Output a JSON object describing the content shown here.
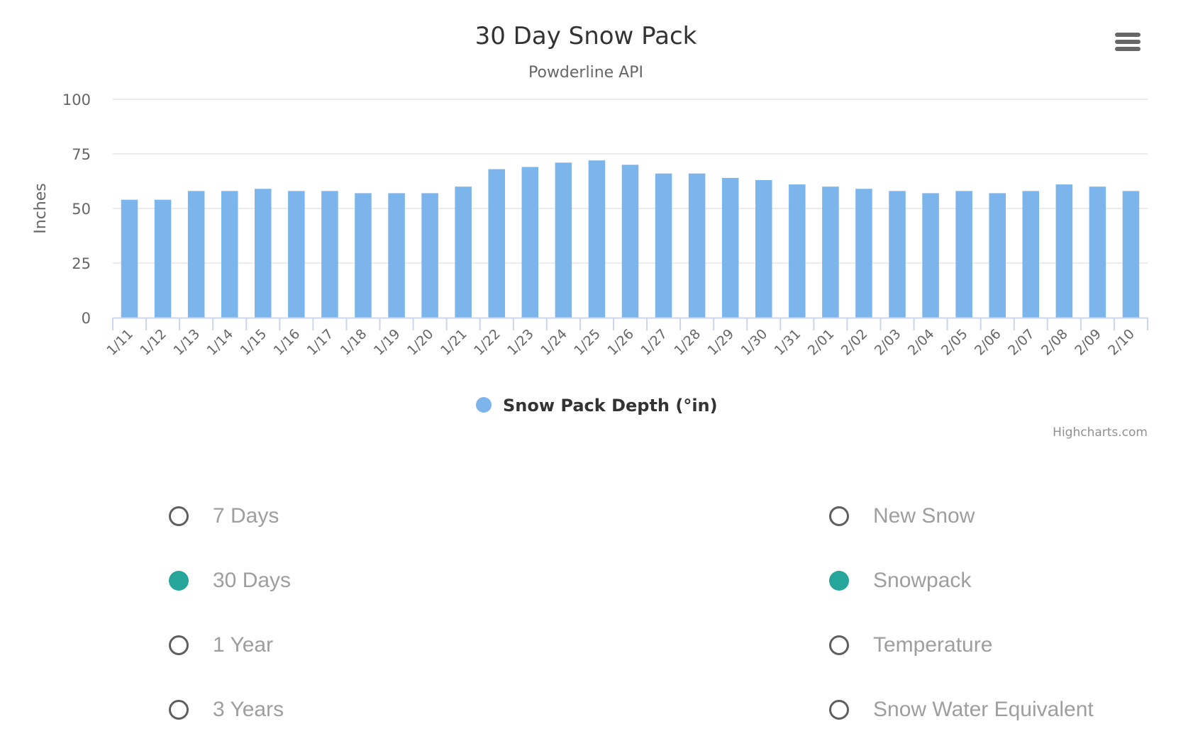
{
  "chart_data": {
    "type": "bar",
    "title": "30 Day Snow Pack",
    "subtitle": "Powderline API",
    "ylabel": "Inches",
    "xlabel": "",
    "ylim": [
      0,
      100
    ],
    "yticks": [
      0,
      25,
      50,
      75,
      100
    ],
    "grid": true,
    "legend_position": "bottom-center",
    "categories": [
      "1/11",
      "1/12",
      "1/13",
      "1/14",
      "1/15",
      "1/16",
      "1/17",
      "1/18",
      "1/19",
      "1/20",
      "1/21",
      "1/22",
      "1/23",
      "1/24",
      "1/25",
      "1/26",
      "1/27",
      "1/28",
      "1/29",
      "1/30",
      "1/31",
      "2/01",
      "2/02",
      "2/03",
      "2/04",
      "2/05",
      "2/06",
      "2/07",
      "2/08",
      "2/09",
      "2/10"
    ],
    "series": [
      {
        "name": "Snow Pack Depth (°in)",
        "color": "#7cb5ec",
        "values": [
          54,
          54,
          58,
          58,
          59,
          58,
          58,
          57,
          57,
          57,
          60,
          68,
          69,
          71,
          72,
          70,
          66,
          66,
          64,
          63,
          61,
          60,
          59,
          58,
          57,
          58,
          57,
          58,
          61,
          60,
          58
        ]
      }
    ],
    "credits": "Highcharts.com"
  },
  "menu": {
    "icon": "hamburger-menu-icon"
  },
  "range_options": [
    {
      "label": "7 Days",
      "checked": false
    },
    {
      "label": "30 Days",
      "checked": true
    },
    {
      "label": "1 Year",
      "checked": false
    },
    {
      "label": "3 Years",
      "checked": false
    }
  ],
  "metric_options": [
    {
      "label": "New Snow",
      "checked": false
    },
    {
      "label": "Snowpack",
      "checked": true
    },
    {
      "label": "Temperature",
      "checked": false
    },
    {
      "label": "Snow Water Equivalent",
      "checked": false
    }
  ],
  "colors": {
    "accent": "#26a69a",
    "bar": "#7cb5ec",
    "radio_border": "#5f5f5f",
    "option_text": "#9e9e9e"
  }
}
